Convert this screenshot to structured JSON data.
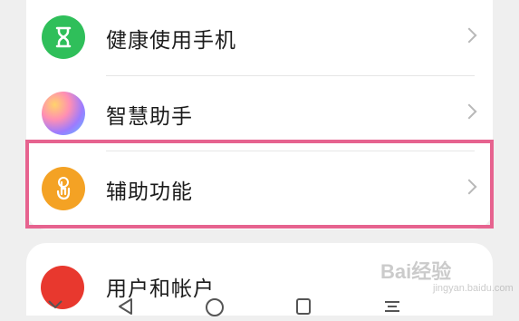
{
  "settings": {
    "items": [
      {
        "label": "健康使用手机",
        "icon": "hourglass-icon",
        "color": "#2fbf5a"
      },
      {
        "label": "智慧助手",
        "icon": "assistant-gradient-icon"
      },
      {
        "label": "辅助功能",
        "icon": "touch-hand-icon",
        "color": "#f4a224"
      }
    ],
    "bottom_item": {
      "label": "用户和帐户",
      "icon": "user-icon",
      "color": "#e8382e"
    }
  },
  "highlight_color": "#e6638f",
  "watermark": {
    "text": "Bai经验",
    "sub": "jingyan.baidu.com"
  }
}
